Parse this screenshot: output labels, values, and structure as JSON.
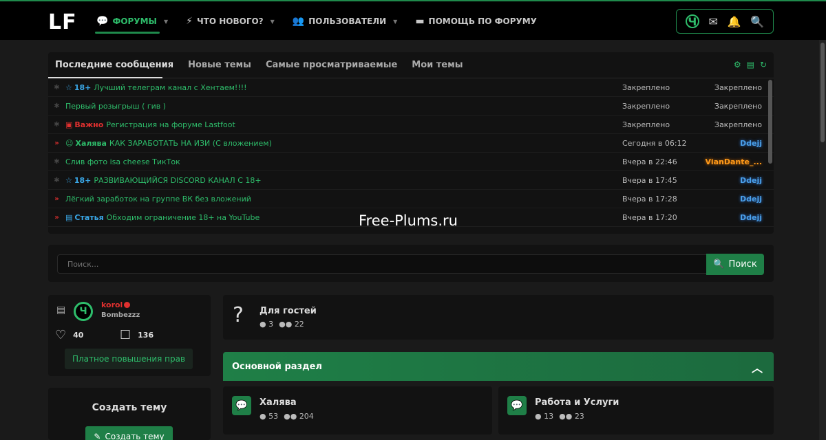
{
  "header": {
    "logo": "LF",
    "nav": [
      {
        "label": "ФОРУМЫ",
        "icon": "chat-icon",
        "active": true
      },
      {
        "label": "ЧТО НОВОГО?",
        "icon": "bolt-icon"
      },
      {
        "label": "ПОЛЬЗОВАТЕЛИ",
        "icon": "users-icon"
      },
      {
        "label": "ПОМОЩЬ ПО ФОРУМУ",
        "icon": "folder-icon"
      }
    ],
    "user_logo": "Ч"
  },
  "latest": {
    "tabs": [
      "Последние сообщения",
      "Новые темы",
      "Самые просматриваемые",
      "Мои темы"
    ],
    "rows": [
      {
        "prefix": "18+",
        "prefix_color": "#3aa8e8",
        "prefix_icon": "☆",
        "title": "Лучший телеграм канал с Хентаем!!!!",
        "date": "Закреплено",
        "user": "Закреплено",
        "user_style": "plain",
        "hot": false
      },
      {
        "prefix": "",
        "prefix_color": "",
        "prefix_icon": "",
        "title": "Первый розыгрыш ( гив )",
        "date": "Закреплено",
        "user": "Закреплено",
        "user_style": "plain",
        "hot": false
      },
      {
        "prefix": "Важно",
        "prefix_color": "#e0302f",
        "prefix_icon": "▣",
        "title": "Регистрация на форуме Lastfoot",
        "date": "Закреплено",
        "user": "Закреплено",
        "user_style": "plain",
        "hot": false
      },
      {
        "prefix": "Халява",
        "prefix_color": "#2ebd6b",
        "prefix_icon": "☺",
        "title": "КАК ЗАРАБОТАТЬ НА ИЗИ (С вложением)",
        "date": "Сегодня в 06:12",
        "user": "Ddejj",
        "user_style": "blue",
        "hot": true
      },
      {
        "prefix": "",
        "prefix_color": "",
        "prefix_icon": "",
        "title": "Слив фото isa cheese ТикТок",
        "date": "Вчера в 22:46",
        "user": "VianDante_...",
        "user_style": "orange",
        "hot": false
      },
      {
        "prefix": "18+",
        "prefix_color": "#3aa8e8",
        "prefix_icon": "☆",
        "title": "РАЗВИВАЮЩИЙСЯ DISCORD КАНАЛ С 18+",
        "date": "Вчера в 17:45",
        "user": "Ddejj",
        "user_style": "blue",
        "hot": false
      },
      {
        "prefix": "",
        "prefix_color": "",
        "prefix_icon": "",
        "title": "Лёгкий заработок на группе ВК без вложений",
        "date": "Вчера в 17:28",
        "user": "Ddejj",
        "user_style": "blue",
        "hot": true
      },
      {
        "prefix": "Статья",
        "prefix_color": "#3aa8e8",
        "prefix_icon": "▤",
        "title": "Обходим ограничение 18+ на YouTube",
        "date": "Вчера в 17:20",
        "user": "Ddejj",
        "user_style": "blue",
        "hot": true
      }
    ]
  },
  "watermark": "Free-Plums.ru",
  "search": {
    "placeholder": "Поиск...",
    "button": "Поиск"
  },
  "profile": {
    "name": "korol",
    "title": "Bombezzz",
    "likes": "40",
    "messages": "136",
    "upgrade": "Платное повышения прав",
    "avatar_letter": "Ч"
  },
  "create": {
    "title": "Создать тему",
    "button": "Создать тему"
  },
  "guest": {
    "title": "Для гостей",
    "threads": "3",
    "posts": "22"
  },
  "section": {
    "title": "Основной раздел"
  },
  "forums": [
    {
      "title": "Халява",
      "threads": "53",
      "posts": "204"
    },
    {
      "title": "Работа и Услуги",
      "threads": "13",
      "posts": "23"
    }
  ]
}
